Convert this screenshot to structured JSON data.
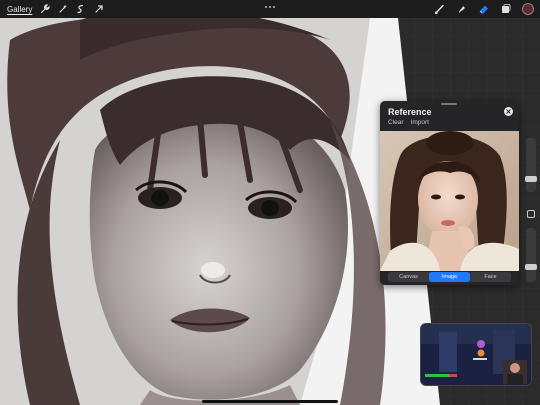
{
  "toolbar": {
    "gallery_label": "Gallery",
    "left_icons": [
      "wrench-icon",
      "magic-wand-icon",
      "selection-icon",
      "transform-arrow-icon"
    ],
    "right_icons": [
      "brush-icon",
      "smudge-icon",
      "eraser-icon",
      "layers-icon"
    ],
    "active_tool": "eraser-icon",
    "color_swatch": "#5a2a2a"
  },
  "reference": {
    "title": "Reference",
    "actions": [
      "Clear",
      "Import"
    ],
    "tabs": [
      "Canvas",
      "Image",
      "Face"
    ],
    "active_tab": "Image"
  },
  "colors": {
    "accent": "#1f7aff",
    "panel_bg": "#252527",
    "toolbar_bg": "#1c1c1c"
  }
}
